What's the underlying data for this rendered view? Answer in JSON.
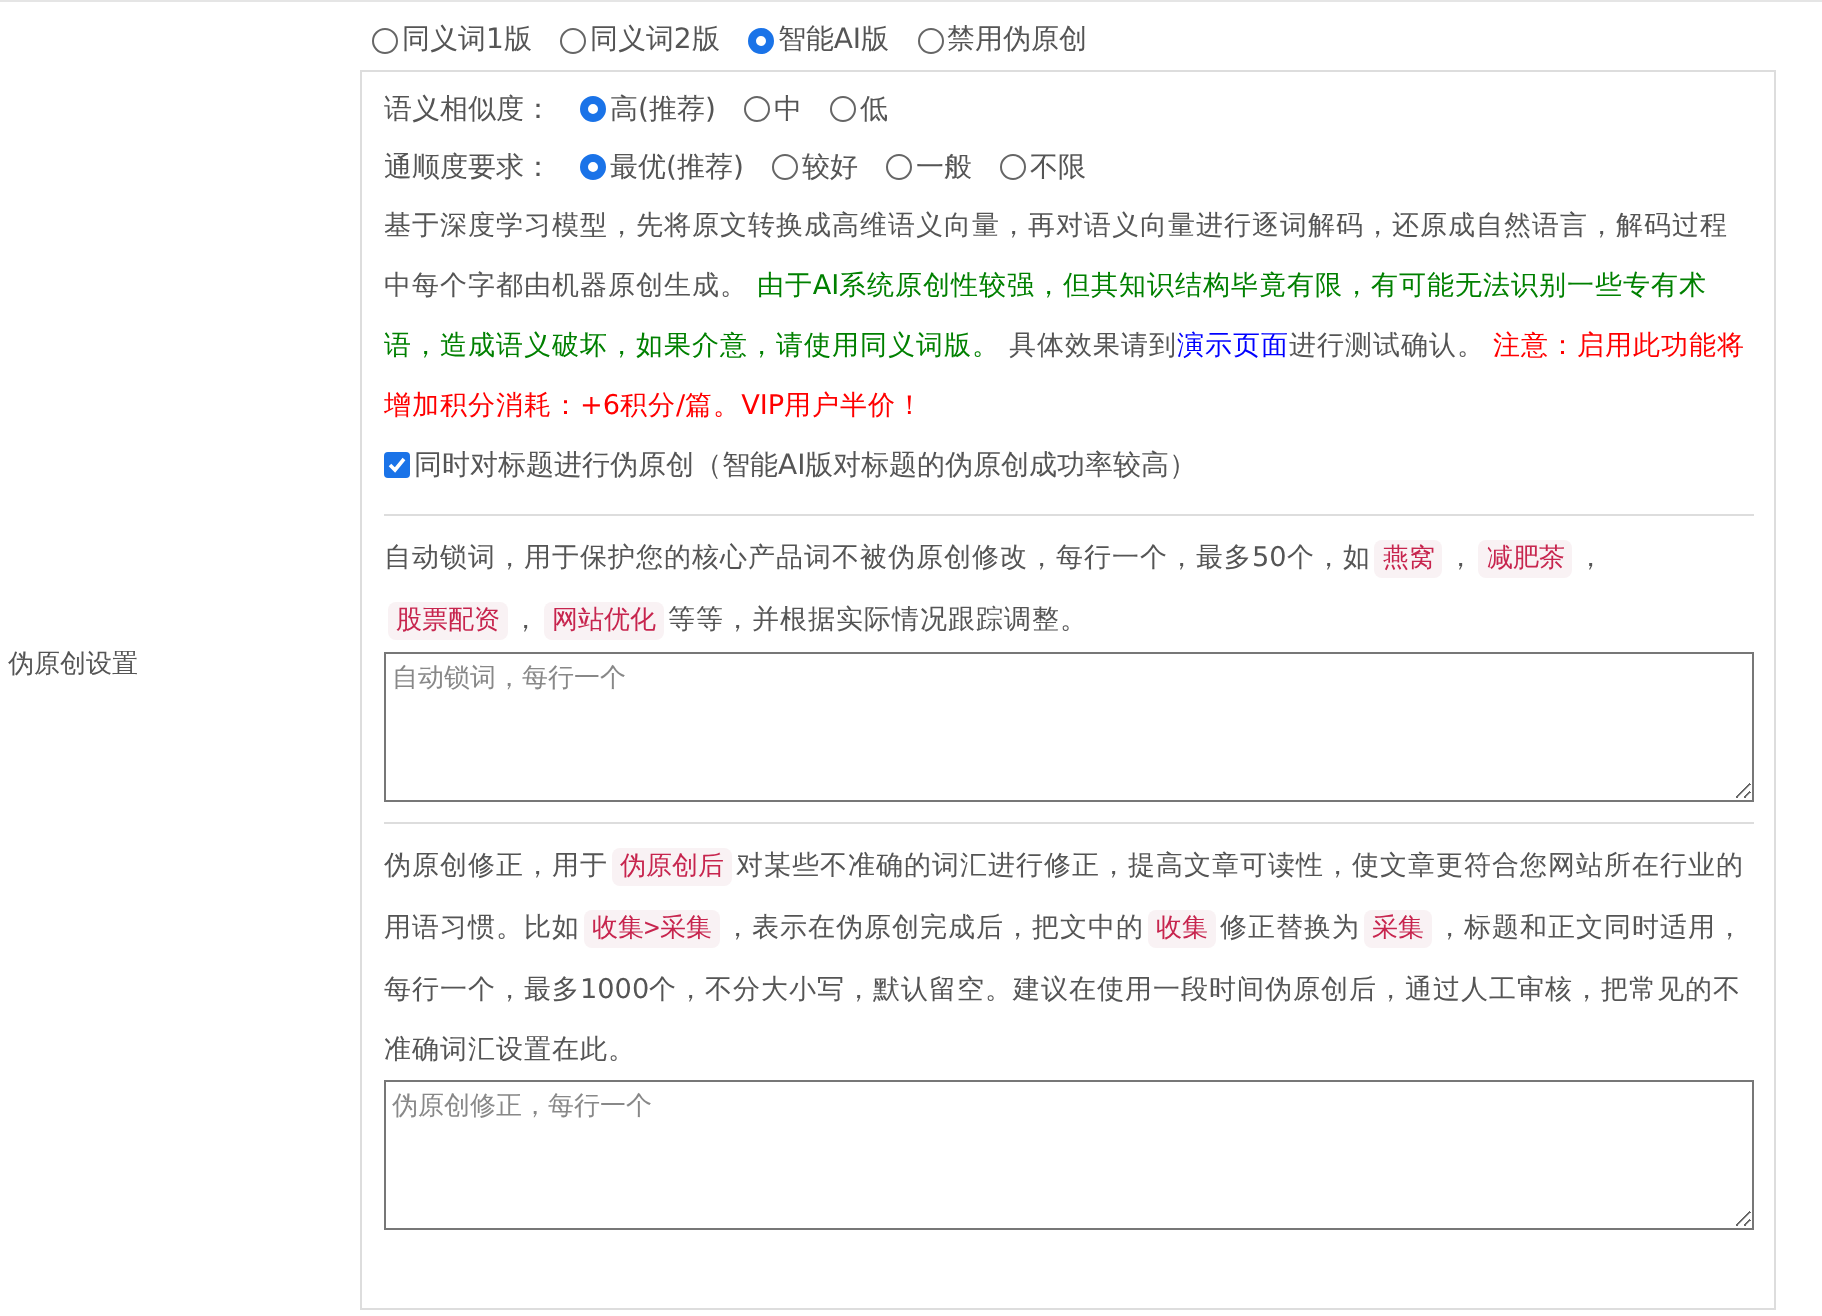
{
  "mode_options": [
    {
      "label": "同义词1版",
      "selected": false
    },
    {
      "label": "同义词2版",
      "selected": false
    },
    {
      "label": "智能AI版",
      "selected": true
    },
    {
      "label": "禁用伪原创",
      "selected": false
    }
  ],
  "settings_label": "伪原创设置",
  "similarity": {
    "label": "语义相似度：",
    "options": [
      {
        "label": "高(推荐)",
        "selected": true
      },
      {
        "label": "中",
        "selected": false
      },
      {
        "label": "低",
        "selected": false
      }
    ]
  },
  "fluency": {
    "label": "通顺度要求：",
    "options": [
      {
        "label": "最优(推荐)",
        "selected": true
      },
      {
        "label": "较好",
        "selected": false
      },
      {
        "label": "一般",
        "selected": false
      },
      {
        "label": "不限",
        "selected": false
      }
    ]
  },
  "ai_description": [
    {
      "kind": "plain",
      "text": "基于深度学习模型，先将原文转换成高维语义向量，再对语义向量进行逐词解码，还原成自然语言，解码过程中每个字都由机器原创生成。 "
    },
    {
      "kind": "green",
      "text": "由于AI系统原创性较强，但其知识结构毕竟有限，有可能无法识别一些专有术语，造成语义破坏，如果介意，请使用同义词版。"
    },
    {
      "kind": "plain",
      "text": " 具体效果请到"
    },
    {
      "kind": "link",
      "text": "演示页面"
    },
    {
      "kind": "plain",
      "text": "进行测试确认。 "
    },
    {
      "kind": "red",
      "text": "注意：启用此功能将增加积分消耗：+6积分/篇。VIP用户半价！"
    }
  ],
  "title_option": {
    "label": "同时对标题进行伪原创（智能AI版对标题的伪原创成功率较高）",
    "checked": true
  },
  "lock_words": {
    "description": [
      {
        "kind": "plain",
        "text": "自动锁词，用于保护您的核心产品词不被伪原创修改，每行一个，最多50个，如"
      },
      {
        "kind": "code",
        "text": "燕窝"
      },
      {
        "kind": "plain",
        "text": "，"
      },
      {
        "kind": "code",
        "text": "减肥茶"
      },
      {
        "kind": "plain",
        "text": "，"
      },
      {
        "kind": "code",
        "text": "股票配资"
      },
      {
        "kind": "plain",
        "text": "，"
      },
      {
        "kind": "code",
        "text": "网站优化"
      },
      {
        "kind": "plain",
        "text": "等等，并根据实际情况跟踪调整。"
      }
    ],
    "placeholder": "自动锁词，每行一个"
  },
  "corrections": {
    "description": [
      {
        "kind": "plain",
        "text": "伪原创修正，用于"
      },
      {
        "kind": "code",
        "text": "伪原创后"
      },
      {
        "kind": "plain",
        "text": "对某些不准确的词汇进行修正，提高文章可读性，使文章更符合您网站所在行业的用语习惯。比如"
      },
      {
        "kind": "code",
        "text": "收集>采集"
      },
      {
        "kind": "plain",
        "text": "，表示在伪原创完成后，把文中的"
      },
      {
        "kind": "code",
        "text": "收集"
      },
      {
        "kind": "plain",
        "text": "修正替换为"
      },
      {
        "kind": "code",
        "text": "采集"
      },
      {
        "kind": "plain",
        "text": "，标题和正文同时适用，每行一个，最多1000个，不分大小写，默认留空。建议在使用一段时间伪原创后，通过人工审核，把常见的不准确词汇设置在此。"
      }
    ],
    "placeholder": "伪原创修正，每行一个"
  }
}
